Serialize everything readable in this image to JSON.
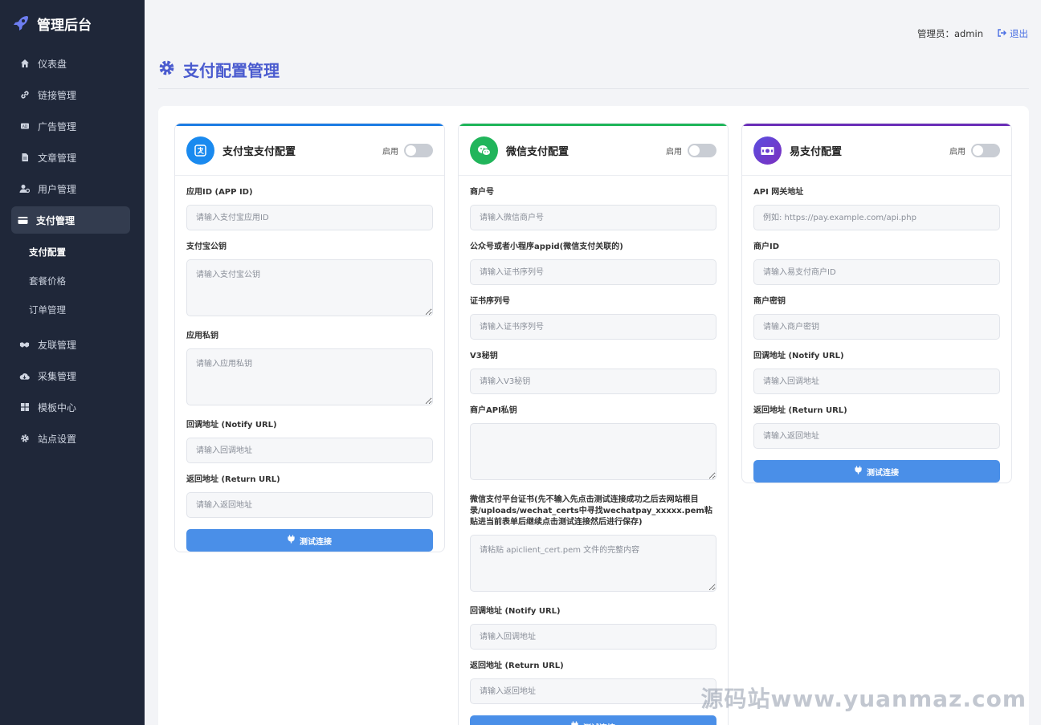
{
  "brand": {
    "title": "管理后台",
    "icon": "rocket-icon"
  },
  "nav": [
    {
      "label": "仪表盘",
      "icon": "home-icon"
    },
    {
      "label": "链接管理",
      "icon": "link-icon"
    },
    {
      "label": "广告管理",
      "icon": "ad-icon"
    },
    {
      "label": "文章管理",
      "icon": "file-icon"
    },
    {
      "label": "用户管理",
      "icon": "user-cog-icon"
    },
    {
      "label": "支付管理",
      "icon": "credit-card-icon",
      "active": true
    }
  ],
  "subnav": [
    {
      "label": "支付配置",
      "active": true
    },
    {
      "label": "套餐价格"
    },
    {
      "label": "订单管理"
    }
  ],
  "nav2": [
    {
      "label": "友联管理",
      "icon": "handshake-icon"
    },
    {
      "label": "采集管理",
      "icon": "cloud-download-icon"
    },
    {
      "label": "模板中心",
      "icon": "grid-icon"
    },
    {
      "label": "站点设置",
      "icon": "gear-icon"
    }
  ],
  "topbar": {
    "admin": "管理员：admin",
    "logout": "退出"
  },
  "page": {
    "title": "支付配置管理"
  },
  "enable_label": "启用",
  "test_label": "测试连接",
  "colors": {
    "alipay": "#1d7de4",
    "wechat": "#20b65a",
    "epay": "#6b2fb8",
    "accent": "#4a5bcf",
    "button": "#4a8fe8"
  },
  "alipay": {
    "title": "支付宝支付配置",
    "fields": [
      {
        "label": "应用ID (APP ID)",
        "placeholder": "请输入支付宝应用ID"
      },
      {
        "label": "支付宝公钥",
        "placeholder": "请输入支付宝公钥"
      },
      {
        "label": "应用私钥",
        "placeholder": "请输入应用私钥"
      },
      {
        "label": "回调地址 (Notify URL)",
        "placeholder": "请输入回调地址"
      },
      {
        "label": "返回地址 (Return URL)",
        "placeholder": "请输入返回地址"
      }
    ]
  },
  "wechat": {
    "title": "微信支付配置",
    "fields": [
      {
        "label": "商户号",
        "placeholder": "请输入微信商户号"
      },
      {
        "label": "公众号或者小程序appid(微信支付关联的)",
        "placeholder": "请输入证书序列号"
      },
      {
        "label": "证书序列号",
        "placeholder": "请输入证书序列号"
      },
      {
        "label": "V3秘钥",
        "placeholder": "请输入V3秘钥"
      },
      {
        "label": "商户API私钥",
        "placeholder": ""
      },
      {
        "label": "微信支付平台证书(先不输入先点击测试连接成功之后去网站根目录/uploads/wechat_certs中寻找wechatpay_xxxxx.pem粘贴进当前表单后继续点击测试连接然后进行保存)",
        "placeholder": "请粘贴 apiclient_cert.pem 文件的完整内容"
      },
      {
        "label": "回调地址 (Notify URL)",
        "placeholder": "请输入回调地址"
      },
      {
        "label": "返回地址 (Return URL)",
        "placeholder": "请输入返回地址"
      }
    ]
  },
  "epay": {
    "title": "易支付配置",
    "fields": [
      {
        "label": "API 网关地址",
        "placeholder": "例如: https://pay.example.com/api.php"
      },
      {
        "label": "商户ID",
        "placeholder": "请输入易支付商户ID"
      },
      {
        "label": "商户密钥",
        "placeholder": "请输入商户密钥"
      },
      {
        "label": "回调地址 (Notify URL)",
        "placeholder": "请输入回调地址"
      },
      {
        "label": "返回地址 (Return URL)",
        "placeholder": "请输入返回地址"
      }
    ]
  },
  "watermark": "源码站www.yuanmaz.com"
}
